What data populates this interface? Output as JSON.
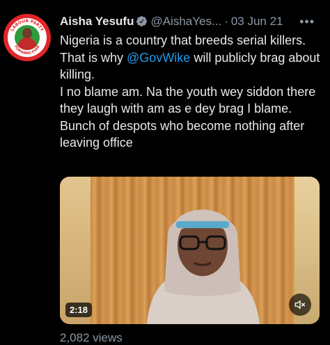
{
  "tweet": {
    "author_name": "Aisha Yesufu",
    "verified_icon": "verified-badge-icon",
    "handle": "@AishaYes...",
    "separator": "·",
    "date": "03 Jun 21",
    "more_icon": "more-options-icon",
    "body": {
      "line1_prefix": "Nigeria is a country that breeds serial killers. That is why ",
      "mention": "@GovWike",
      "line1_suffix": " will publicly brag about killing.",
      "line2": "I no blame am. Na the youth wey siddon there they laugh with am as e dey brag I blame.",
      "line3": "Bunch of despots who become nothing after leaving office"
    },
    "avatar_text": "LABOUR PARTY",
    "avatar_subtext": "FORWARD EVER",
    "video": {
      "duration": "2:18",
      "mute_icon": "speaker-muted-icon"
    },
    "views": "2,082 views"
  },
  "colors": {
    "background": "#000000",
    "text": "#e7e9ea",
    "secondary": "#8b98a5",
    "link": "#1d9bf0",
    "verified": "#8b98a5"
  }
}
